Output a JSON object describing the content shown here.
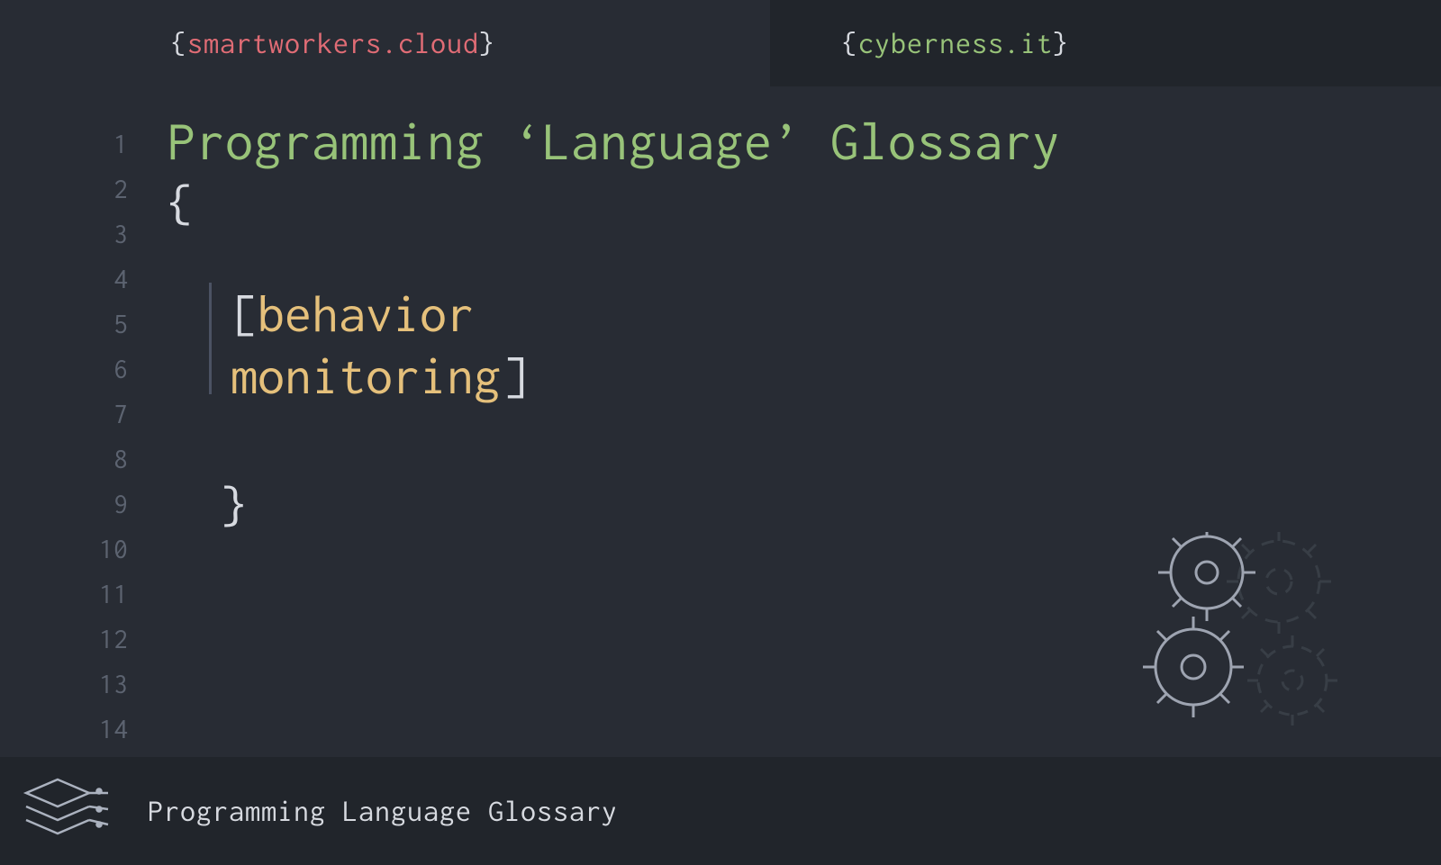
{
  "tabs": {
    "left": {
      "text": "smartworkers.cloud",
      "active": true
    },
    "right": {
      "text": "cyberness.it",
      "active": false
    }
  },
  "gutter": {
    "start": 1,
    "end": 14
  },
  "code": {
    "title": "Programming ‘Language’ Glossary",
    "term_line1": "behavior",
    "term_line2": "monitoring"
  },
  "footer": {
    "title": "Programming Language Glossary"
  }
}
